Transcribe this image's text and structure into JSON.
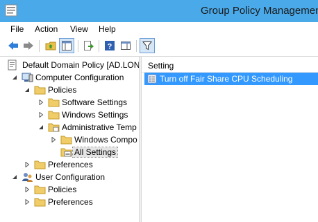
{
  "window": {
    "title": "Group Policy Managemen"
  },
  "menu": [
    "File",
    "Action",
    "View",
    "Help"
  ],
  "toolbar": [
    {
      "name": "back-button",
      "icon": "back-arrow-icon"
    },
    {
      "name": "forward-button",
      "icon": "forward-arrow-icon"
    },
    {
      "name": "up-one-level-button",
      "icon": "folder-up-icon"
    },
    {
      "name": "show-hide-console-tree-button",
      "icon": "console-tree-icon"
    },
    {
      "name": "export-list-button",
      "icon": "export-icon"
    },
    {
      "name": "help-button",
      "icon": "help-icon"
    },
    {
      "name": "show-action-pane-button",
      "icon": "action-pane-icon"
    },
    {
      "name": "filter-button",
      "icon": "filter-icon"
    }
  ],
  "tree": {
    "root": "Default Domain Policy [AD.LON",
    "computer_config": "Computer Configuration",
    "policies": "Policies",
    "software_settings": "Software Settings",
    "windows_settings": "Windows Settings",
    "admin_templates": "Administrative Temp",
    "windows_components": "Windows Compo",
    "all_settings": "All Settings",
    "preferences": "Preferences",
    "user_config": "User Configuration",
    "user_policies": "Policies",
    "user_preferences": "Preferences"
  },
  "list": {
    "column_header": "Setting",
    "rows": [
      "Turn off Fair Share CPU Scheduling"
    ]
  },
  "colors": {
    "titlebar": "#4aa9e9",
    "selection": "#3399ff"
  }
}
